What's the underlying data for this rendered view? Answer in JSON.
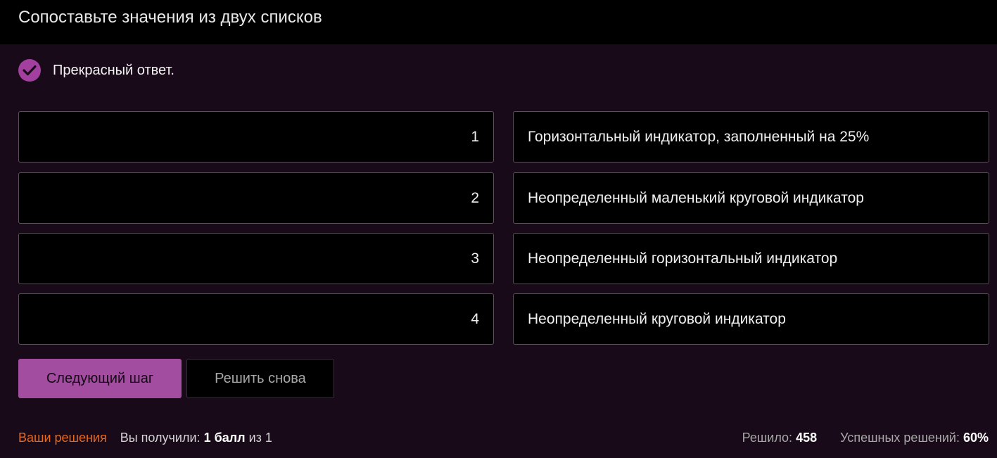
{
  "header": {
    "title": "Сопоставьте значения из двух списков"
  },
  "feedback": {
    "icon": "check-icon",
    "text": "Прекрасный ответ.",
    "accent": "#a3409f"
  },
  "pairs": [
    {
      "left": "1",
      "right": "Горизонтальный индикатор, заполненный на 25%"
    },
    {
      "left": "2",
      "right": "Неопределенный маленький круговой индикатор"
    },
    {
      "left": "3",
      "right": "Неопределенный горизонтальный индикатор"
    },
    {
      "left": "4",
      "right": "Неопределенный круговой индикатор"
    }
  ],
  "buttons": {
    "next": "Следующий шаг",
    "retry": "Решить снова"
  },
  "footer": {
    "your_solutions": "Ваши решения",
    "got_label": "Вы получили:",
    "got_value": "1 балл",
    "got_suffix": "из 1",
    "solved_label": "Решило:",
    "solved_value": "458",
    "success_label": "Успешных решений:",
    "success_value": "60%"
  }
}
